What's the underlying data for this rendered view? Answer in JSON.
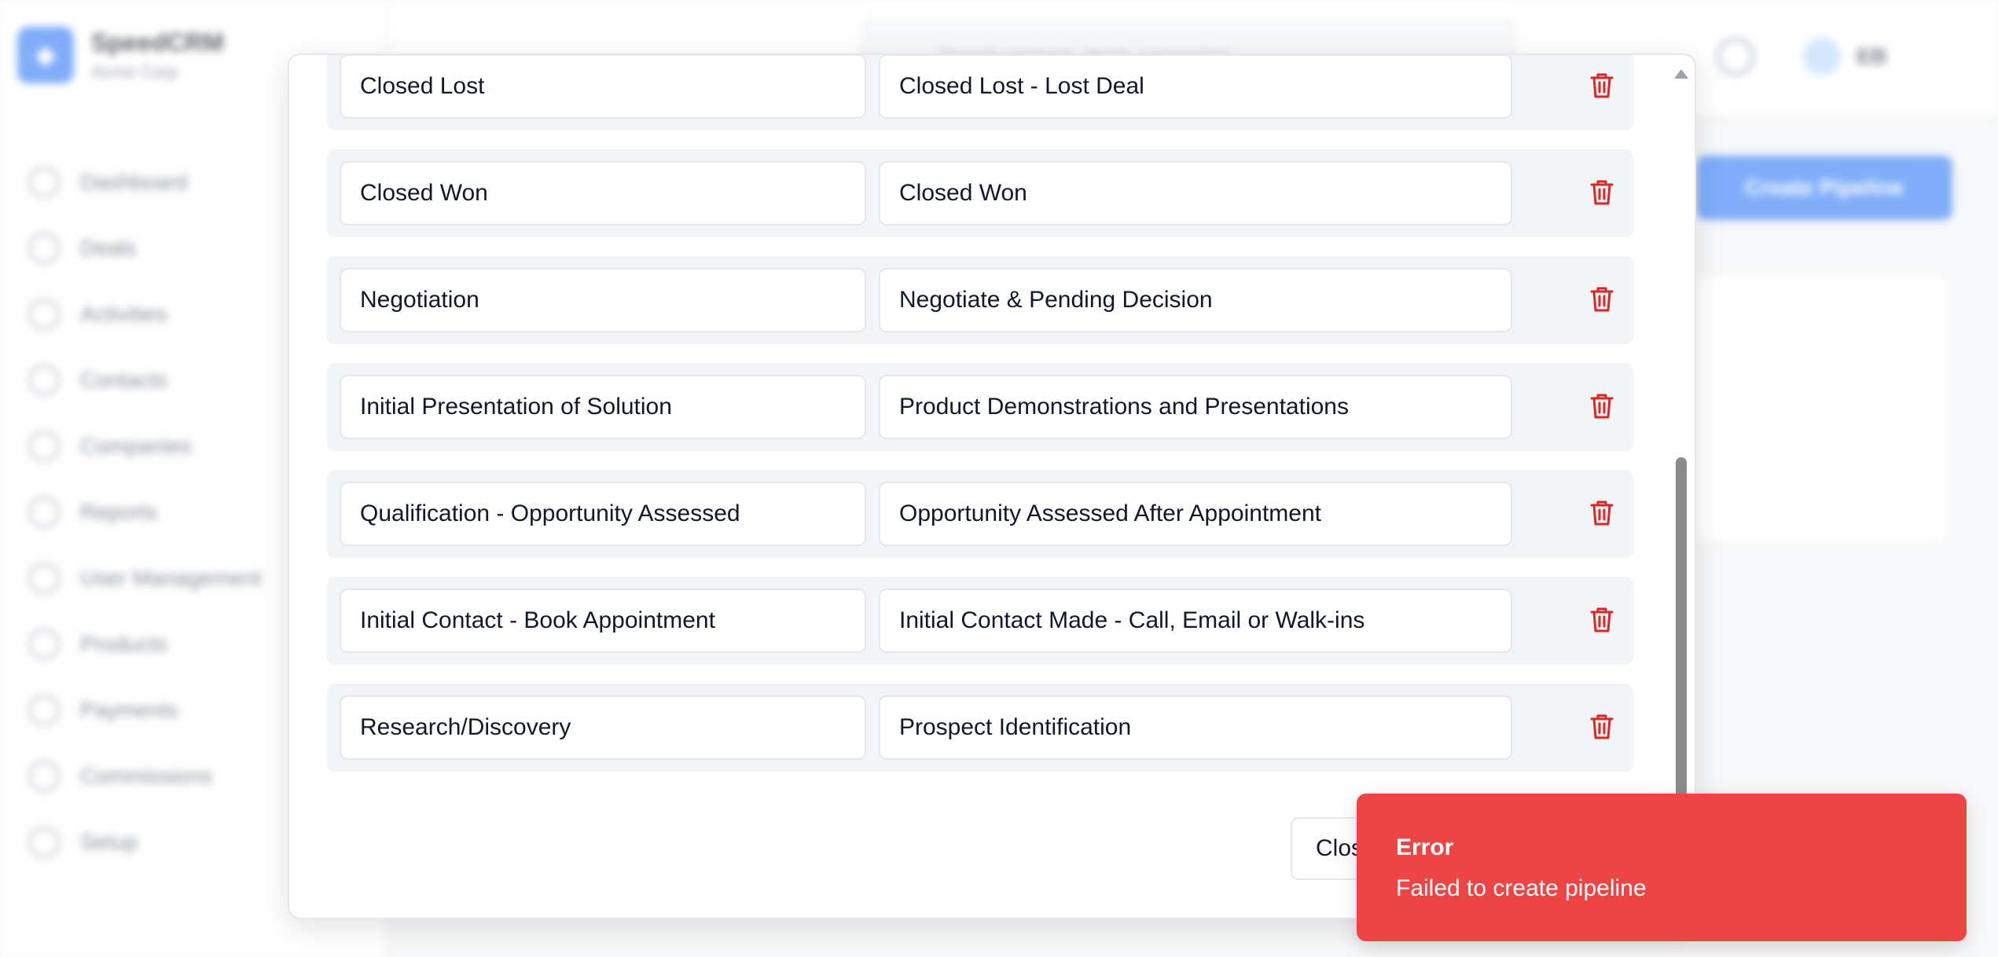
{
  "background": {
    "brand": {
      "name": "SpeedCRM",
      "subtitle": "Acme Corp"
    },
    "nav_items": [
      {
        "label": "Dashboard"
      },
      {
        "label": "Deals"
      },
      {
        "label": "Activities"
      },
      {
        "label": "Contacts"
      },
      {
        "label": "Companies"
      },
      {
        "label": "Reports"
      },
      {
        "label": "User Management"
      },
      {
        "label": "Products"
      },
      {
        "label": "Payments"
      },
      {
        "label": "Commissions"
      },
      {
        "label": "Setup"
      }
    ],
    "search_placeholder": "Search contacts, deals, companies...",
    "user_initials": "EB",
    "create_button_label": "Create Pipeline"
  },
  "modal": {
    "stages": [
      {
        "name": "Closed Lost",
        "description": "Closed Lost - Lost Deal"
      },
      {
        "name": "Closed Won",
        "description": "Closed Won"
      },
      {
        "name": "Negotiation",
        "description": "Negotiate & Pending Decision"
      },
      {
        "name": "Initial Presentation of Solution",
        "description": "Product Demonstrations and Presentations"
      },
      {
        "name": "Qualification - Opportunity Assessed",
        "description": "Opportunity Assessed After Appointment"
      },
      {
        "name": "Initial Contact - Book Appointment",
        "description": "Initial Contact Made - Call, Email or Walk-ins"
      },
      {
        "name": "Research/Discovery",
        "description": "Prospect Identification"
      }
    ],
    "close_label": "Close"
  },
  "toast": {
    "title": "Error",
    "message": "Failed to create pipeline"
  },
  "colors": {
    "primary": "#3b82f6",
    "danger": "#ef4444",
    "trash_icon": "#dc2626",
    "row_background": "#f3f4f6"
  }
}
